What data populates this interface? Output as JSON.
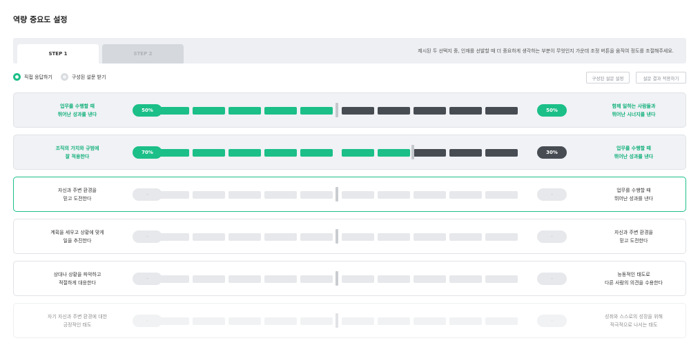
{
  "page": {
    "title": "역량 중요도 설정"
  },
  "tabs": [
    {
      "label": "STEP 1",
      "active": true
    },
    {
      "label": "STEP 2",
      "active": false
    }
  ],
  "instruction": "제시된 두 선택지 중, 인재를 선발할 때 더 중요하게 생각하는 부분이 무엇인지 가운데 조정 버튼을 움직여 정도를 조절해주세요.",
  "mode": {
    "options": [
      {
        "label": "직접 응답하기",
        "selected": true
      },
      {
        "label": "구성된 설문 받기",
        "selected": false
      }
    ]
  },
  "buttons": {
    "preset": "구성된 설문 설정",
    "apply": "설문 결과 적용하기"
  },
  "colors": {
    "accent": "#1bbf87",
    "dark": "#474c53",
    "empty": "#e6e8eb"
  },
  "rows": [
    {
      "left": "업무를 수행할 때\n뛰어난 성과를 낸다",
      "right": "함께 일하는 사람들과\n뛰어난 시너지를 낸다",
      "left_value": "50%",
      "right_value": "50%",
      "left_segments": 5,
      "state": "filled"
    },
    {
      "left": "조직의 가치와 규범에\n잘 적용한다",
      "right": "업무를 수행할 때\n뛰어난 성과를 낸다",
      "left_value": "70%",
      "right_value": "30%",
      "left_segments": 7,
      "state": "filled"
    },
    {
      "left": "자신과 주변 환경을\n믿고 도전한다",
      "right": "업무를 수행할 때\n뛰어난 성과를 낸다",
      "left_value": "-",
      "right_value": "-",
      "left_segments": null,
      "state": "active"
    },
    {
      "left": "계획을 세우고 상황에 맞게\n일을 추진한다",
      "right": "자신과 주변 환경을\n믿고 도전한다",
      "left_value": "-",
      "right_value": "-",
      "left_segments": null,
      "state": "empty"
    },
    {
      "left": "상대나 상황을 파악하고\n적절하게 대응한다",
      "right": "능동적인 태도로\n다른 사람의 의견을 수용한다",
      "left_value": "-",
      "right_value": "-",
      "left_segments": null,
      "state": "empty"
    },
    {
      "left": "자기 자신과 주변 환경에 대한\n긍정적인 태도",
      "right": "성취와 스스로의 성장을 위해\n적극적으로 나서는 태도",
      "left_value": "-",
      "right_value": "-",
      "left_segments": null,
      "state": "faded"
    }
  ]
}
